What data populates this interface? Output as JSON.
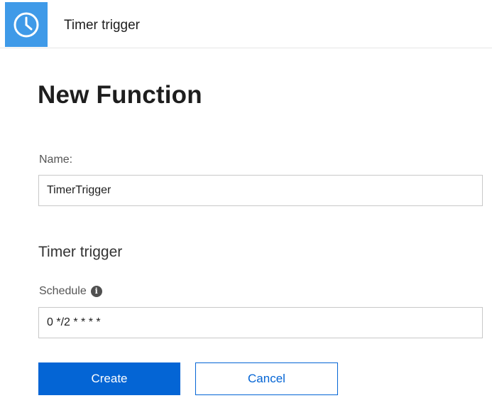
{
  "header": {
    "icon": "clock-icon",
    "icon_bg_color": "#3f9ae8",
    "title": "Timer trigger"
  },
  "page_title": "New Function",
  "form": {
    "name_label": "Name:",
    "name_value": "TimerTrigger",
    "section_heading": "Timer trigger",
    "schedule_label": "Schedule",
    "schedule_info_icon": "info-icon",
    "schedule_value": "0 */2 * * * *"
  },
  "buttons": {
    "create_label": "Create",
    "cancel_label": "Cancel",
    "primary_color": "#0465d5"
  }
}
